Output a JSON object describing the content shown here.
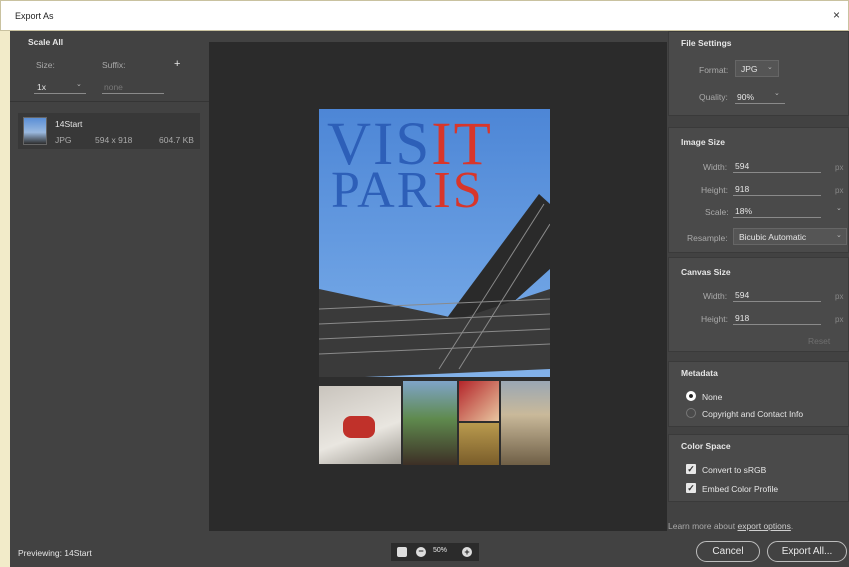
{
  "window": {
    "title": "Export As",
    "close_glyph": "×"
  },
  "scale_all": {
    "heading": "Scale All",
    "size_label": "Size:",
    "suffix_label": "Suffix:",
    "add_glyph": "+",
    "size_value": "1x",
    "suffix_placeholder": "none",
    "asset": {
      "name": "14Start",
      "format": "JPG",
      "dimensions": "594 x 918",
      "filesize": "604.7 KB"
    }
  },
  "poster": {
    "line1_a": "VIS",
    "line1_b": "IT",
    "line2_a": "PAR",
    "line2_b": "IS"
  },
  "file_settings": {
    "heading": "File Settings",
    "format_label": "Format:",
    "format_value": "JPG",
    "quality_label": "Quality:",
    "quality_value": "90%"
  },
  "image_size": {
    "heading": "Image Size",
    "width_label": "Width:",
    "width_value": "594",
    "height_label": "Height:",
    "height_value": "918",
    "scale_label": "Scale:",
    "scale_value": "18%",
    "resample_label": "Resample:",
    "resample_value": "Bicubic Automatic",
    "unit": "px"
  },
  "canvas_size": {
    "heading": "Canvas Size",
    "width_label": "Width:",
    "width_value": "594",
    "height_label": "Height:",
    "height_value": "918",
    "unit": "px",
    "reset_label": "Reset"
  },
  "metadata": {
    "heading": "Metadata",
    "option_none": "None",
    "option_copyright": "Copyright and Contact Info",
    "selected": "None"
  },
  "color_space": {
    "heading": "Color Space",
    "convert_label": "Convert to sRGB",
    "convert_checked": true,
    "embed_label": "Embed Color Profile",
    "embed_checked": true
  },
  "learn_more": {
    "prefix": "Learn more about ",
    "link": "export options",
    "suffix": "."
  },
  "footer": {
    "previewing": "Previewing: 14Start",
    "zoom": "50%",
    "cancel_label": "Cancel",
    "export_label": "Export All..."
  },
  "colors": {
    "panel_bg": "#424242",
    "preview_bg": "#2b2b2b",
    "sky": "#4d86d6",
    "title_red": "#d8362b",
    "title_blue": "#2d5fb8"
  }
}
